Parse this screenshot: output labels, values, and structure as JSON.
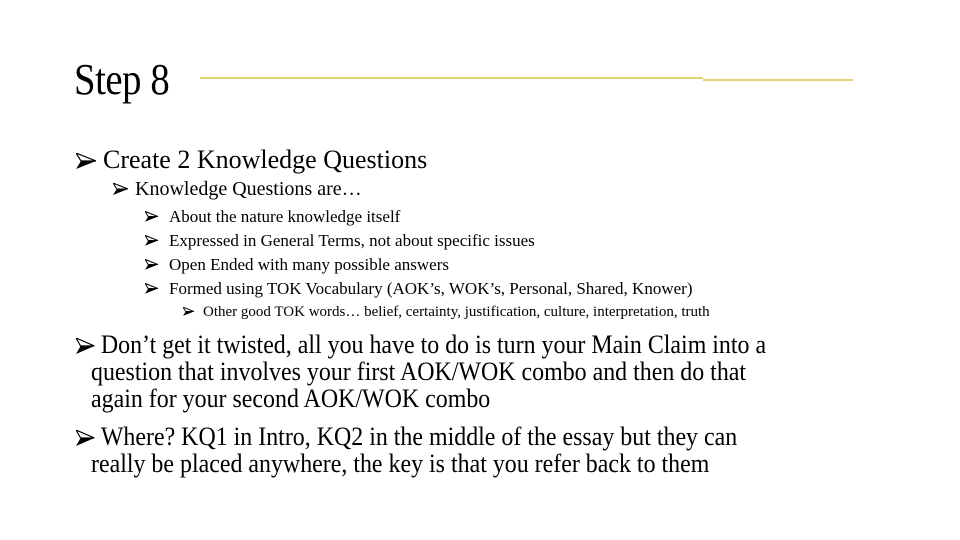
{
  "slide": {
    "title": "Step 8",
    "accent_color": "#e3d272",
    "bullet_icon": "arrow-bullet-icon",
    "items": [
      {
        "level": 1,
        "text": "Create 2 Knowledge Questions"
      },
      {
        "level": 2,
        "text": "Knowledge Questions are…"
      },
      {
        "level": 3,
        "text": "About the nature knowledge itself"
      },
      {
        "level": 3,
        "text": "Expressed in General Terms, not about specific issues"
      },
      {
        "level": 3,
        "text": "Open Ended with many possible answers"
      },
      {
        "level": 3,
        "text": "Formed using TOK Vocabulary (AOK’s, WOK’s, Personal, Shared, Knower)"
      },
      {
        "level": 4,
        "text": "Other good TOK words… belief, certainty, justification, culture, interpretation, truth"
      }
    ],
    "paragraphs": [
      {
        "lines": [
          "Don’t get it twisted, all you have to do is turn your Main Claim into a",
          "question that involves your first AOK/WOK combo and then do that",
          "again for your second AOK/WOK combo"
        ]
      },
      {
        "lines": [
          "Where? KQ1 in Intro, KQ2 in the middle of the essay but they can",
          "really be placed anywhere, the key is that you refer back to them"
        ]
      }
    ]
  }
}
